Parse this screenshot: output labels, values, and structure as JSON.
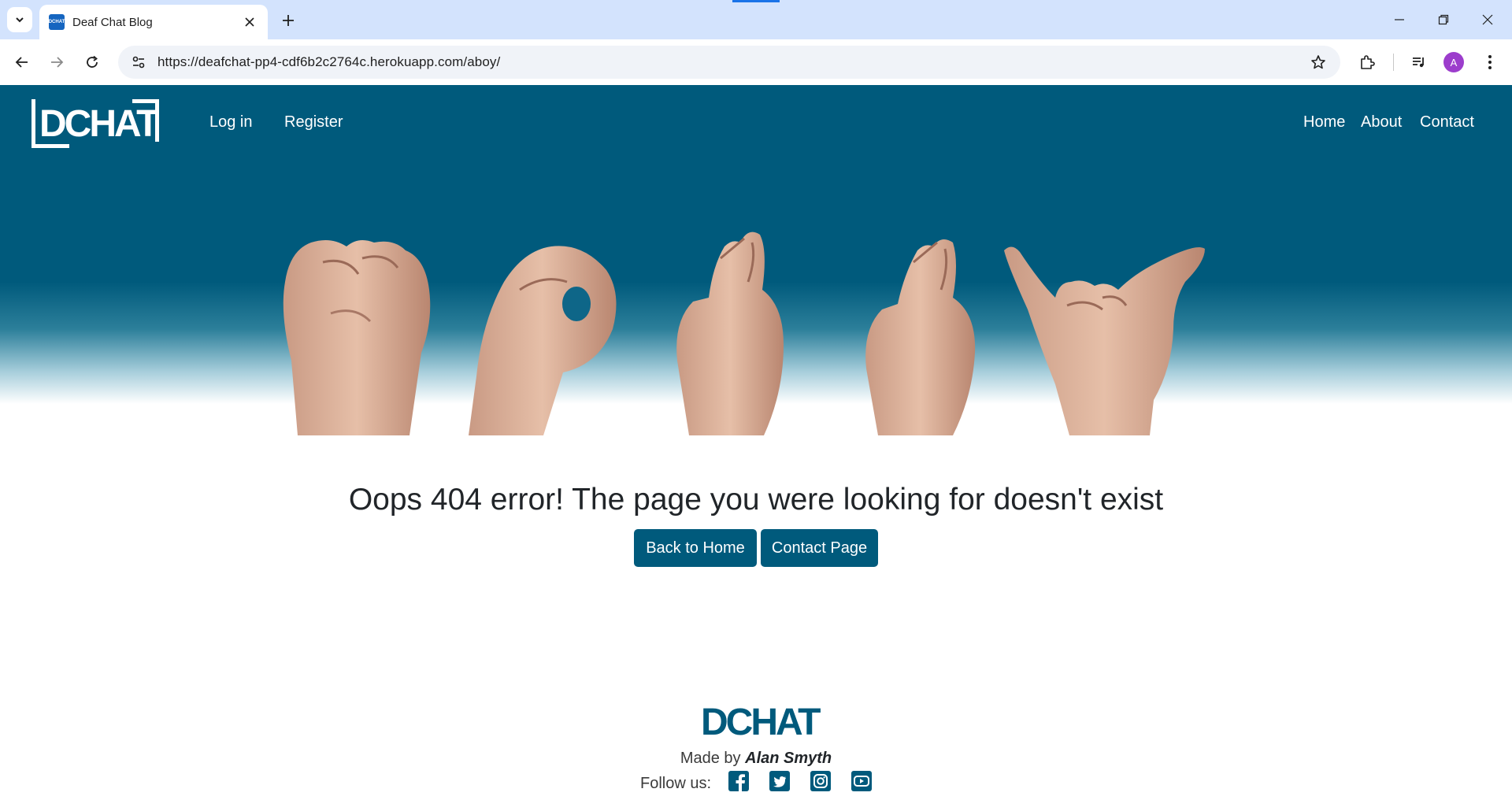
{
  "browser": {
    "tab_title": "Deaf Chat Blog",
    "favicon_text": "DCHAT",
    "url": "https://deafchat-pp4-cdf6b2c2764c.herokuapp.com/aboy/",
    "avatar_letter": "A"
  },
  "navbar": {
    "logo_text": "DCHAT",
    "left_links": [
      "Log in",
      "Register"
    ],
    "right_links": [
      "Home",
      "About",
      "Contact"
    ]
  },
  "main": {
    "error_title": "Oops 404 error! The page you were looking for doesn't exist",
    "buttons": [
      "Back to Home",
      "Contact Page"
    ]
  },
  "footer": {
    "logo_text": "DCHAT",
    "made_by_prefix": "Made by",
    "author": "Alan Smyth",
    "follow_label": "Follow us:",
    "socials": [
      "facebook-icon",
      "twitter-icon",
      "instagram-icon",
      "youtube-icon"
    ]
  },
  "colors": {
    "brand": "#005a7c",
    "tab_strip": "#d3e3fd",
    "avatar": "#9c3dcc"
  }
}
